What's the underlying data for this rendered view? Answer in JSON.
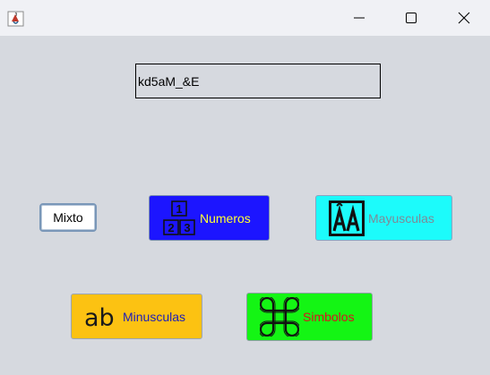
{
  "window": {
    "title": "",
    "icons": {
      "app": "java-cup-icon",
      "minimize": "minimize-icon",
      "maximize": "maximize-icon",
      "close": "close-icon"
    }
  },
  "password_field": {
    "value": "kd5aM_&E"
  },
  "buttons": {
    "mixto": {
      "label": "Mixto",
      "bg": "#ffffff",
      "fg": "#000000"
    },
    "numeros": {
      "label": "Numeros",
      "icon": "numbers-blocks-icon",
      "bg": "#1c15ff",
      "fg": "#ffff33"
    },
    "mayusculas": {
      "label": "Mayusculas",
      "icon": "uppercase-aa-icon",
      "bg": "#1cfbfb",
      "fg": "#7d8b97"
    },
    "minusculas": {
      "label": "Minusculas",
      "icon": "lowercase-ab-icon",
      "bg": "#fcc212",
      "fg": "#1d1fb8"
    },
    "simbolos": {
      "label": "Simbolos",
      "icon": "command-symbol-icon",
      "bg": "#14f514",
      "fg": "#d8141e"
    }
  }
}
